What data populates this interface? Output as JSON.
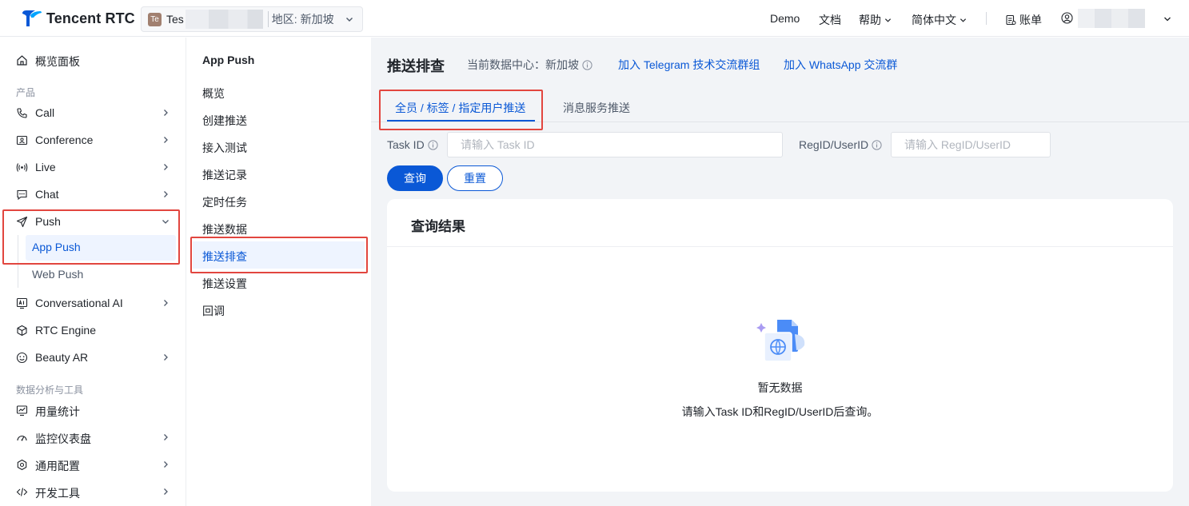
{
  "topbar": {
    "brand": "Tencent RTC",
    "project": {
      "badge": "Te",
      "name": "Tes",
      "region": "地区: 新加坡"
    },
    "nav": {
      "demo": "Demo",
      "docs": "文档",
      "help": "帮助",
      "language": "简体中文",
      "billing": "账单"
    }
  },
  "sidebar": {
    "overview": "概览面板",
    "section_products": "产品",
    "items": {
      "call": "Call",
      "conference": "Conference",
      "live": "Live",
      "chat": "Chat",
      "push": "Push",
      "app_push": "App Push",
      "web_push": "Web Push",
      "conversational_ai": "Conversational AI",
      "rtc_engine": "RTC Engine",
      "beauty_ar": "Beauty AR"
    },
    "section_analytics": "数据分析与工具",
    "tools": {
      "usage": "用量统计",
      "monitor": "监控仪表盘",
      "config": "通用配置",
      "dev_tools": "开发工具"
    }
  },
  "submenu": {
    "title": "App Push",
    "items": [
      "概览",
      "创建推送",
      "接入测试",
      "推送记录",
      "定时任务",
      "推送数据",
      "推送排查",
      "推送设置",
      "回调"
    ],
    "active_index": 6
  },
  "main": {
    "title": "推送排查",
    "data_center": "当前数据中心：新加坡",
    "telegram_link": "加入 Telegram 技术交流群组",
    "whatsapp_link": "加入 WhatsApp 交流群",
    "tabs": [
      "全员 / 标签 / 指定用户推送",
      "消息服务推送"
    ],
    "active_tab": 0,
    "filters": {
      "task_id_label": "Task ID",
      "task_id_placeholder": "请输入 Task ID",
      "regid_label": "RegID/UserID",
      "regid_placeholder": "请输入 RegID/UserID"
    },
    "buttons": {
      "query": "查询",
      "reset": "重置"
    },
    "results": {
      "title": "查询结果",
      "empty_title": "暂无数据",
      "empty_desc": "请输入Task ID和RegID/UserID后查询。"
    }
  },
  "colors": {
    "accent": "#0a58d6",
    "highlight": "#e2463f",
    "background": "#f2f4f7"
  }
}
